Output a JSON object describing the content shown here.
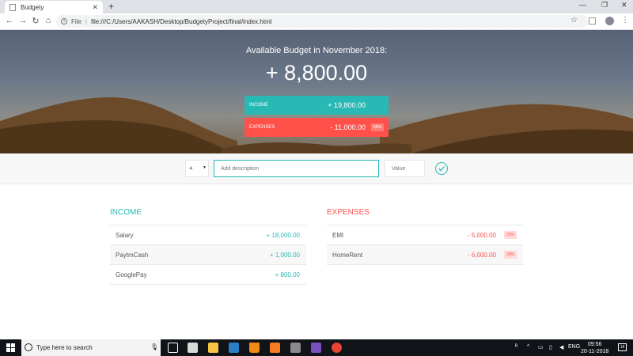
{
  "browser": {
    "tab_title": "Budgety",
    "url": "file:///C:/Users/AAKASH/Desktop/BudgetyProject/final/index.html",
    "url_scheme_label": "File"
  },
  "budget": {
    "title": "Available Budget in November 2018:",
    "value": "+ 8,800.00",
    "income_label": "Income",
    "income_value": "+ 19,800.00",
    "expenses_label": "Expenses",
    "expenses_value": "- 11,000.00",
    "expenses_percentage": "56%"
  },
  "add_form": {
    "type_value": "+",
    "description_placeholder": "Add description",
    "value_placeholder": "Value"
  },
  "income": {
    "title": "INCOME",
    "items": [
      {
        "description": "Salary",
        "value": "+ 18,000.00"
      },
      {
        "description": "PaytmCash",
        "value": "+ 1,000.00"
      },
      {
        "description": "GooglePay",
        "value": "+ 800.00"
      }
    ]
  },
  "expenses": {
    "title": "EXPENSES",
    "items": [
      {
        "description": "EMI",
        "value": "- 5,000.00",
        "percentage": "25%"
      },
      {
        "description": "HomeRent",
        "value": "- 6,000.00",
        "percentage": "30%"
      }
    ]
  },
  "colors": {
    "income": "#28b9b5",
    "expenses": "#ff5049"
  },
  "taskbar": {
    "search_placeholder": "Type here to search",
    "language": "ENG",
    "time": "09:56",
    "date": "20-11-2018",
    "notification_count": "19"
  }
}
